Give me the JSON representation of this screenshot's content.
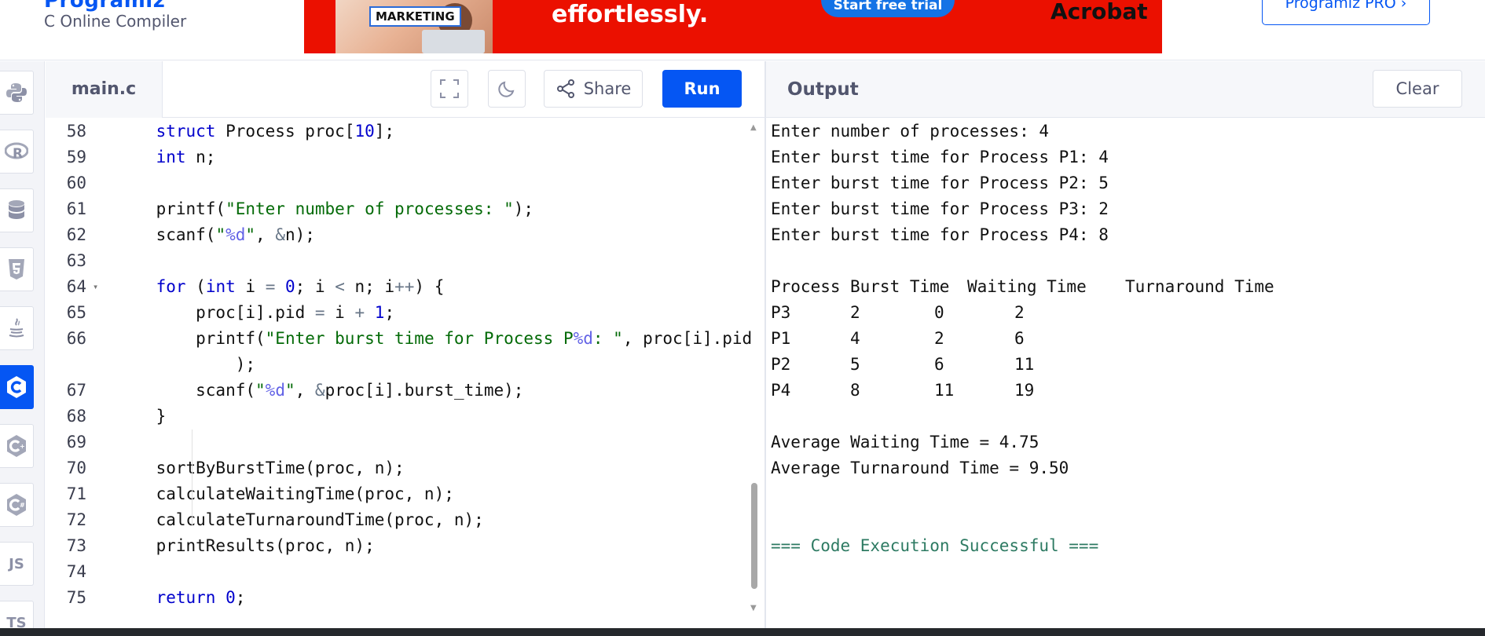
{
  "header": {
    "logo_text": "Programiz",
    "subtitle": "C Online Compiler",
    "pro_button": "Programiz PRO ›",
    "ad": {
      "tag": "MARKETING",
      "headline": "effortlessly.",
      "cta": "Start free trial",
      "brand": "Acrobat"
    }
  },
  "sidebar": {
    "languages": [
      {
        "name": "python",
        "icon": "python-icon",
        "active": false
      },
      {
        "name": "r",
        "icon": "r-icon",
        "active": false
      },
      {
        "name": "sql",
        "icon": "database-icon",
        "active": false
      },
      {
        "name": "html",
        "icon": "html5-icon",
        "active": false
      },
      {
        "name": "java",
        "icon": "java-icon",
        "active": false
      },
      {
        "name": "c",
        "icon": "c-icon",
        "active": true
      },
      {
        "name": "cpp",
        "icon": "cpp-icon",
        "active": false
      },
      {
        "name": "csharp",
        "icon": "csharp-icon",
        "active": false
      },
      {
        "name": "js",
        "label": "JS",
        "icon": "js-icon",
        "active": false
      },
      {
        "name": "ts",
        "label": "TS",
        "icon": "ts-icon",
        "active": false
      }
    ]
  },
  "editor": {
    "file_name": "main.c",
    "share_label": "Share",
    "run_label": "Run",
    "lines": [
      {
        "n": "58",
        "code": "    struct Process proc[10];"
      },
      {
        "n": "59",
        "code": "    int n;"
      },
      {
        "n": "60",
        "code": ""
      },
      {
        "n": "61",
        "code": "    printf(\"Enter number of processes: \");"
      },
      {
        "n": "62",
        "code": "    scanf(\"%d\", &n);"
      },
      {
        "n": "63",
        "code": ""
      },
      {
        "n": "64",
        "code": "    for (int i = 0; i < n; i++) {"
      },
      {
        "n": "65",
        "code": "        proc[i].pid = i + 1;"
      },
      {
        "n": "66",
        "code": "        printf(\"Enter burst time for Process P%d: \", proc[i].pid"
      },
      {
        "n": "",
        "code": "            );"
      },
      {
        "n": "67",
        "code": "        scanf(\"%d\", &proc[i].burst_time);"
      },
      {
        "n": "68",
        "code": "    }"
      },
      {
        "n": "69",
        "code": ""
      },
      {
        "n": "70",
        "code": "    sortByBurstTime(proc, n);"
      },
      {
        "n": "71",
        "code": "    calculateWaitingTime(proc, n);"
      },
      {
        "n": "72",
        "code": "    calculateTurnaroundTime(proc, n);"
      },
      {
        "n": "73",
        "code": "    printResults(proc, n);"
      },
      {
        "n": "74",
        "code": ""
      },
      {
        "n": "75",
        "code": "    return 0;"
      }
    ]
  },
  "output": {
    "title": "Output",
    "clear_label": "Clear",
    "prompts": [
      "Enter number of processes: 4",
      "Enter burst time for Process P1: 4",
      "Enter burst time for Process P2: 5",
      "Enter burst time for Process P3: 2",
      "Enter burst time for Process P4: 8"
    ],
    "table_headers": [
      "Process",
      "Burst Time",
      "Waiting Time",
      "Turnaround Time"
    ],
    "table_rows": [
      [
        "P3",
        "2",
        "0",
        "2"
      ],
      [
        "P1",
        "4",
        "2",
        "6"
      ],
      [
        "P2",
        "5",
        "6",
        "11"
      ],
      [
        "P4",
        "8",
        "11",
        "19"
      ]
    ],
    "avg_waiting": "Average Waiting Time = 4.75",
    "avg_turnaround": "Average Turnaround Time = 9.50",
    "success": "=== Code Execution Successful ==="
  }
}
